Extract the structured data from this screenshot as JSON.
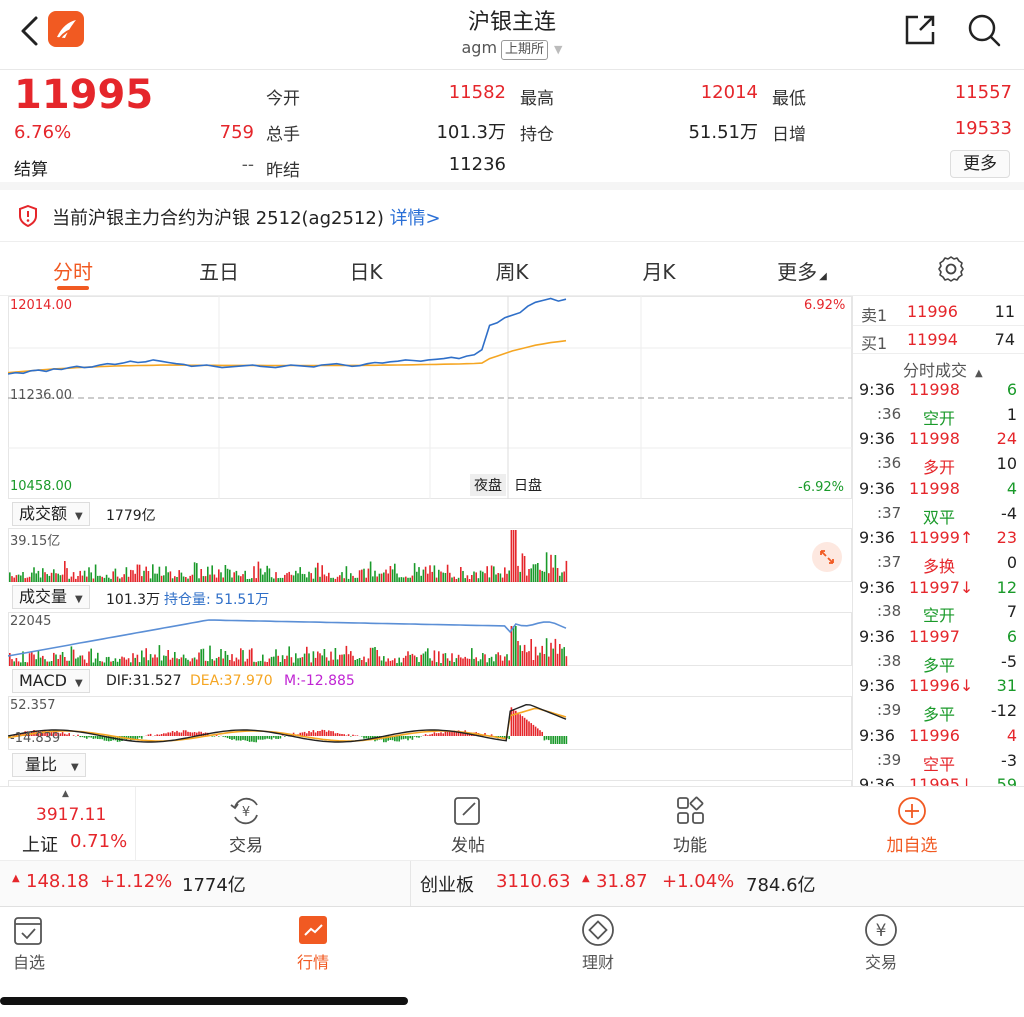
{
  "header": {
    "title": "沪银主连",
    "code": "agm",
    "exchange": "上期所"
  },
  "quote": {
    "price": "11995",
    "pct": "6.76%",
    "change": "759",
    "settle_label": "结算",
    "settle_value": "--",
    "fields": [
      {
        "label": "今开",
        "value": "11582"
      },
      {
        "label": "最高",
        "value": "12014"
      },
      {
        "label": "最低",
        "value": "11557"
      },
      {
        "label": "总手",
        "value": "101.3万"
      },
      {
        "label": "持仓",
        "value": "51.51万"
      },
      {
        "label": "日增",
        "value": "19533"
      },
      {
        "label": "昨结",
        "value": "11236"
      }
    ],
    "more_label": "更多"
  },
  "notice": {
    "text": "当前沪银主力合约为沪银 2512(ag2512) ",
    "link": "详情>"
  },
  "tabs": [
    {
      "label": "分时"
    },
    {
      "label": "五日"
    },
    {
      "label": "日K"
    },
    {
      "label": "周K"
    },
    {
      "label": "月K"
    },
    {
      "label": "更多"
    }
  ],
  "chart": {
    "price_high": "12014.00",
    "price_mid": "11236.00",
    "price_low": "10458.00",
    "pct_high": "6.92%",
    "pct_low": "-6.92%",
    "session_night": "夜盘",
    "session_day": "日盘",
    "amount_btn": "成交额",
    "amount_value": "1779亿",
    "amount_max": "39.15亿",
    "volume_btn": "成交量",
    "volume_value": "101.3万",
    "oi_value": "持仓量: 51.51万",
    "volume_max": "22045",
    "macd_btn": "MACD",
    "dif": "DIF:31.527",
    "dea": "DEA:37.970",
    "m": "M:-12.885",
    "macd_max": "52.357",
    "macd_min": "-14.839",
    "ratio_btn": "量比"
  },
  "chart_data": {
    "type": "line",
    "ylim": [
      10458,
      12014
    ],
    "price_series": [
      11420,
      11430,
      11425,
      11445,
      11450,
      11440,
      11460,
      11455,
      11470,
      11480,
      11470,
      11475,
      11490,
      11500,
      11495,
      11505,
      11520,
      11510,
      11515,
      11530,
      11520,
      11510,
      11500,
      11495,
      11480,
      11485,
      11490,
      11480,
      11470,
      11475,
      11480,
      11485,
      11490,
      11480,
      11475,
      11470,
      11480,
      11490,
      11485,
      11480,
      11475,
      11490,
      11495,
      11500,
      11490,
      11480,
      11485,
      11500,
      11510,
      11505,
      11515,
      11520,
      11530,
      11525,
      11520,
      11530,
      11535,
      11540,
      11550,
      11540,
      11560,
      11570,
      11610,
      11800,
      11820,
      11860,
      11880,
      11900,
      11950,
      11980,
      11995,
      12010,
      11990,
      12005
    ],
    "avg_series": [
      11430,
      11435,
      11440,
      11445,
      11450,
      11455,
      11460,
      11462,
      11465,
      11470,
      11472,
      11475,
      11478,
      11480,
      11482,
      11484,
      11485,
      11486,
      11487,
      11488,
      11489,
      11489,
      11489,
      11489,
      11488,
      11488,
      11488,
      11488,
      11487,
      11487,
      11487,
      11487,
      11487,
      11487,
      11486,
      11486,
      11486,
      11486,
      11486,
      11486,
      11486,
      11486,
      11487,
      11487,
      11487,
      11487,
      11487,
      11488,
      11488,
      11489,
      11489,
      11490,
      11491,
      11492,
      11493,
      11494,
      11495,
      11496,
      11497,
      11498,
      11500,
      11502,
      11505,
      11540,
      11560,
      11580,
      11600,
      11615,
      11630,
      11645,
      11655,
      11665,
      11672,
      11680
    ]
  },
  "orderbook": {
    "ask_label": "卖1",
    "ask_price": "11996",
    "ask_vol": "11",
    "bid_label": "买1",
    "bid_price": "11994",
    "bid_vol": "74",
    "ticks_title": "分时成交"
  },
  "ticks": [
    {
      "time": "9:36",
      "price": "11998",
      "vol": "6",
      "pc": "red",
      "vc": "green"
    },
    {
      "time": ":36",
      "price": "空开",
      "vol": "1",
      "pc": "green",
      "vc": "dark"
    },
    {
      "time": "9:36",
      "price": "11998",
      "vol": "24",
      "pc": "red",
      "vc": "red"
    },
    {
      "time": ":36",
      "price": "多开",
      "vol": "10",
      "pc": "red",
      "vc": "dark"
    },
    {
      "time": "9:36",
      "price": "11998",
      "vol": "4",
      "pc": "red",
      "vc": "green"
    },
    {
      "time": ":37",
      "price": "双平",
      "vol": "-4",
      "pc": "green",
      "vc": "dark"
    },
    {
      "time": "9:36",
      "price": "11999↑",
      "vol": "23",
      "pc": "red",
      "vc": "red"
    },
    {
      "time": ":37",
      "price": "多换",
      "vol": "0",
      "pc": "red",
      "vc": "dark"
    },
    {
      "time": "9:36",
      "price": "11997↓",
      "vol": "12",
      "pc": "red",
      "vc": "green"
    },
    {
      "time": ":38",
      "price": "空开",
      "vol": "7",
      "pc": "green",
      "vc": "dark"
    },
    {
      "time": "9:36",
      "price": "11997",
      "vol": "6",
      "pc": "red",
      "vc": "green"
    },
    {
      "time": ":38",
      "price": "多平",
      "vol": "-5",
      "pc": "green",
      "vc": "dark"
    },
    {
      "time": "9:36",
      "price": "11996↓",
      "vol": "31",
      "pc": "red",
      "vc": "green"
    },
    {
      "time": ":39",
      "price": "多平",
      "vol": "-12",
      "pc": "green",
      "vc": "dark"
    },
    {
      "time": "9:36",
      "price": "11996",
      "vol": "4",
      "pc": "red",
      "vc": "red"
    },
    {
      "time": ":39",
      "price": "空平",
      "vol": "-3",
      "pc": "red",
      "vc": "dark"
    },
    {
      "time": "9:36",
      "price": "11995↓",
      "vol": "59",
      "pc": "red",
      "vc": "green"
    }
  ],
  "actions": {
    "index_value": "3917.11",
    "index_name": "上证",
    "index_pct": "0.71%",
    "trade": "交易",
    "post": "发帖",
    "function": "功能",
    "add_watch": "加自选"
  },
  "index_strip": {
    "left_points": "148.18",
    "left_pct": "+1.12%",
    "left_amount": "1774亿",
    "right_name": "创业板",
    "right_value": "3110.63",
    "right_points": "31.87",
    "right_pct": "+1.04%",
    "right_amount": "784.6亿"
  },
  "nav": [
    {
      "label": "自选"
    },
    {
      "label": "行情"
    },
    {
      "label": "理财"
    },
    {
      "label": "交易"
    }
  ],
  "colors": {
    "accent": "#f15a22",
    "up": "#e5262b",
    "down": "#1a9a2a",
    "price_line": "#2f6fc8",
    "avg_line": "#f5a623"
  }
}
